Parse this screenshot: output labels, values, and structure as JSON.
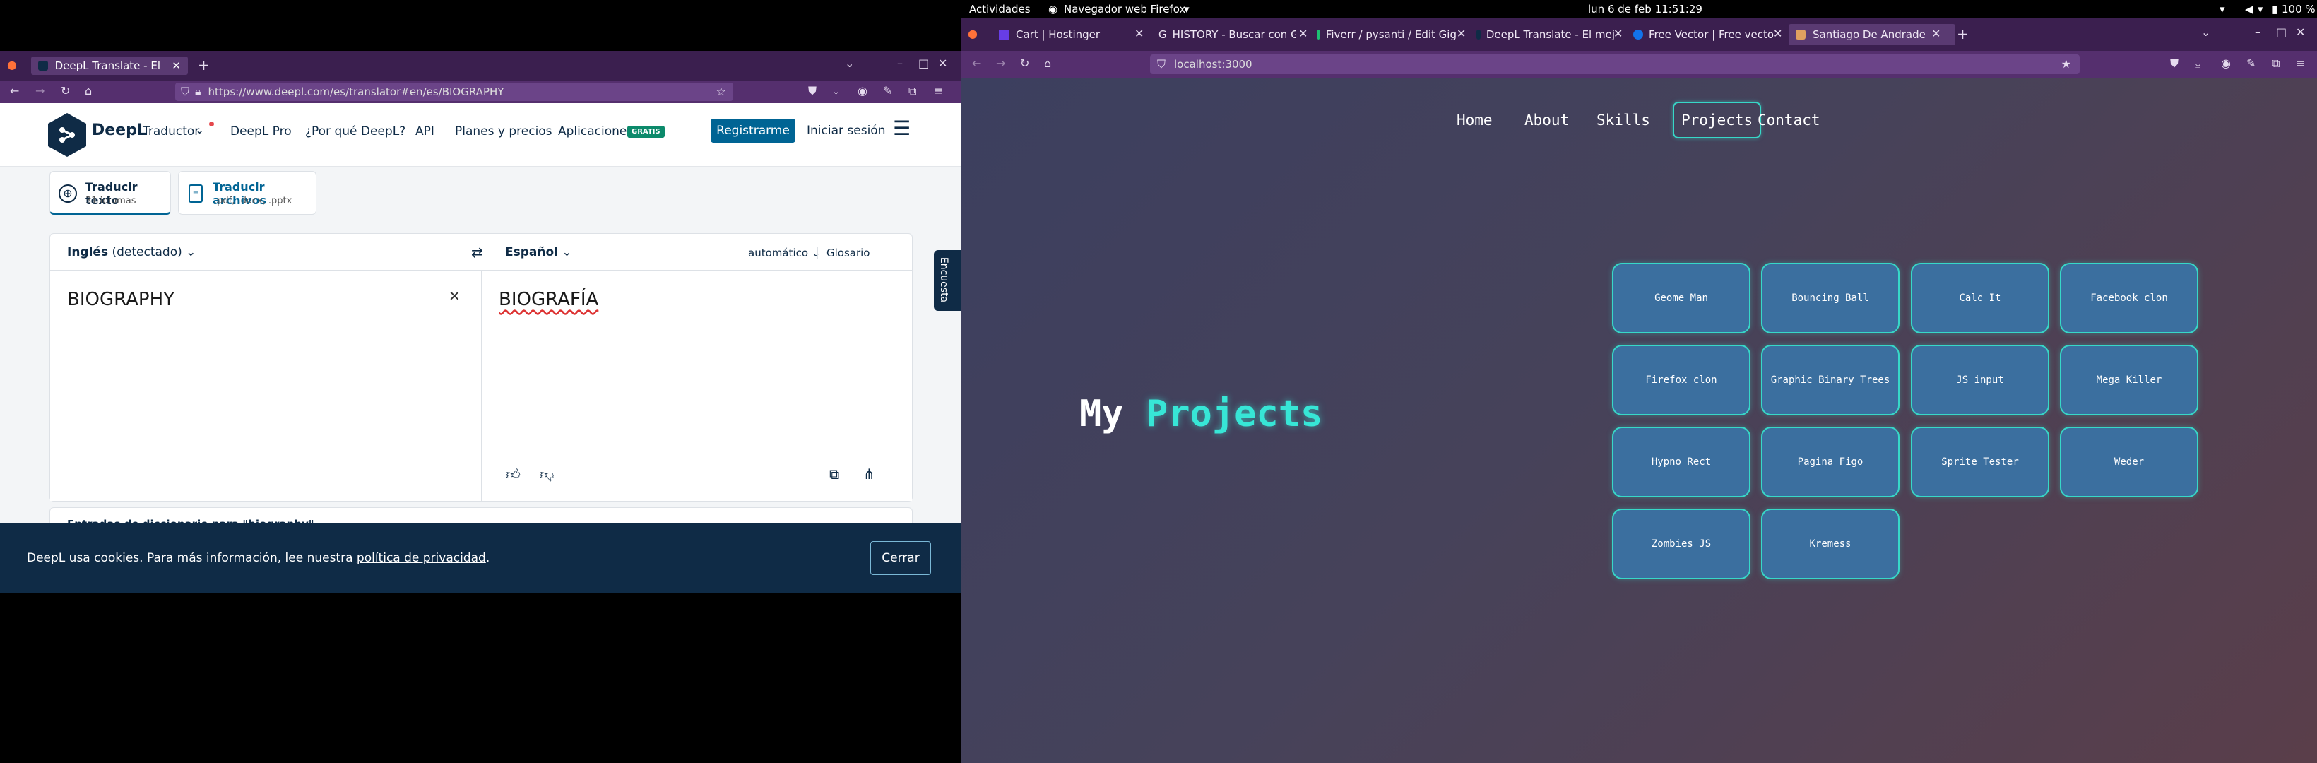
{
  "gnome": {
    "activities": "Actividades",
    "app": "Navegador web Firefox",
    "clock": "lun 6 de feb  11:51:29",
    "battery": "100 %"
  },
  "left": {
    "tab_title": "DeepL Translate - El mejo",
    "url": "https://www.deepl.com/es/translator#en/es/BIOGRAPHY",
    "deepl": {
      "brand": "DeepL",
      "product": "Traductor",
      "nav": [
        "DeepL Pro",
        "¿Por qué DeepL?",
        "API",
        "Planes y precios",
        "Aplicaciones"
      ],
      "badge": "GRATIS",
      "register": "Registrarme",
      "login": "Iniciar sesión",
      "tab_text_title": "Traducir texto",
      "tab_text_sub": "31 idiomas",
      "tab_files_title": "Traducir archivos",
      "tab_files_sub": ".pdf, .docx, .pptx",
      "source_lang": "Inglés",
      "source_detected": "(detectado)",
      "target_lang": "Español",
      "formality": "automático",
      "glossary": "Glosario",
      "source_text": "BIOGRAPHY",
      "target_text": "BIOGRAFÍA",
      "dictionary_peek": "Entradas de diccionario para \"biography\"",
      "survey": "Encuesta",
      "cookie_text": "DeepL usa cookies. Para más información, lee nuestra",
      "cookie_link": "política de privacidad",
      "cookie_end": ".",
      "cookie_close": "Cerrar"
    }
  },
  "right": {
    "tabs": [
      "Cart | Hostinger",
      "HISTORY - Buscar con Go",
      "Fiverr / pysanti / Edit Gig",
      "DeepL Translate - El mej",
      "Free Vector | Free vecto",
      "Santiago De Andrade"
    ],
    "url": "localhost:3000",
    "site": {
      "nav": [
        "Home",
        "About",
        "Skills",
        "Projects",
        "Contact"
      ],
      "active": "Projects",
      "heading_a": "My",
      "heading_b": "Projects",
      "projects": [
        "Geome Man",
        "Bouncing Ball",
        "Calc It",
        "Facebook clon",
        "Firefox clon",
        "Graphic Binary Trees",
        "JS input",
        "Mega Killer",
        "Hypno Rect",
        "Pagina Figo",
        "Sprite Tester",
        "Weder",
        "Zombies JS",
        "Kremess"
      ]
    }
  },
  "colors": {
    "deepl_navy": "#0f2b46",
    "deepl_blue": "#006494",
    "teal_accent": "#37d8c8",
    "firefox_purple": "#552f6e"
  }
}
